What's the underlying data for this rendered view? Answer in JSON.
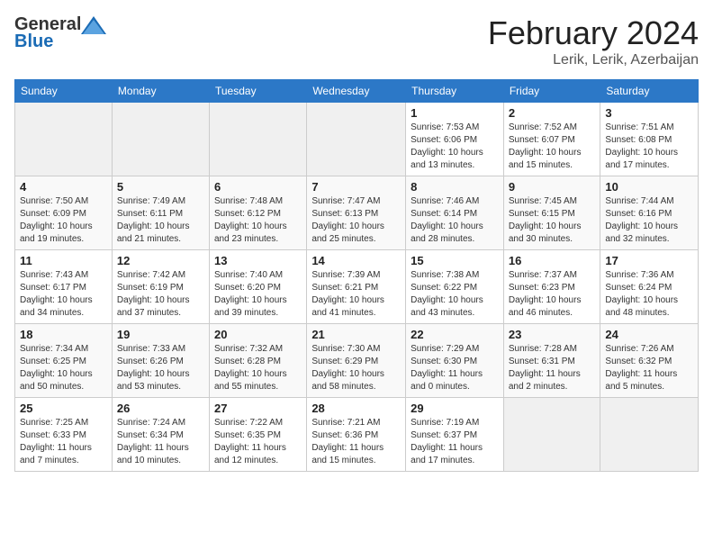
{
  "header": {
    "logo_general": "General",
    "logo_blue": "Blue",
    "title": "February 2024",
    "subtitle": "Lerik, Lerik, Azerbaijan"
  },
  "weekdays": [
    "Sunday",
    "Monday",
    "Tuesday",
    "Wednesday",
    "Thursday",
    "Friday",
    "Saturday"
  ],
  "weeks": [
    [
      {
        "day": "",
        "empty": true
      },
      {
        "day": "",
        "empty": true
      },
      {
        "day": "",
        "empty": true
      },
      {
        "day": "",
        "empty": true
      },
      {
        "day": "1",
        "sunrise": "Sunrise: 7:53 AM",
        "sunset": "Sunset: 6:06 PM",
        "daylight": "Daylight: 10 hours and 13 minutes."
      },
      {
        "day": "2",
        "sunrise": "Sunrise: 7:52 AM",
        "sunset": "Sunset: 6:07 PM",
        "daylight": "Daylight: 10 hours and 15 minutes."
      },
      {
        "day": "3",
        "sunrise": "Sunrise: 7:51 AM",
        "sunset": "Sunset: 6:08 PM",
        "daylight": "Daylight: 10 hours and 17 minutes."
      }
    ],
    [
      {
        "day": "4",
        "sunrise": "Sunrise: 7:50 AM",
        "sunset": "Sunset: 6:09 PM",
        "daylight": "Daylight: 10 hours and 19 minutes."
      },
      {
        "day": "5",
        "sunrise": "Sunrise: 7:49 AM",
        "sunset": "Sunset: 6:11 PM",
        "daylight": "Daylight: 10 hours and 21 minutes."
      },
      {
        "day": "6",
        "sunrise": "Sunrise: 7:48 AM",
        "sunset": "Sunset: 6:12 PM",
        "daylight": "Daylight: 10 hours and 23 minutes."
      },
      {
        "day": "7",
        "sunrise": "Sunrise: 7:47 AM",
        "sunset": "Sunset: 6:13 PM",
        "daylight": "Daylight: 10 hours and 25 minutes."
      },
      {
        "day": "8",
        "sunrise": "Sunrise: 7:46 AM",
        "sunset": "Sunset: 6:14 PM",
        "daylight": "Daylight: 10 hours and 28 minutes."
      },
      {
        "day": "9",
        "sunrise": "Sunrise: 7:45 AM",
        "sunset": "Sunset: 6:15 PM",
        "daylight": "Daylight: 10 hours and 30 minutes."
      },
      {
        "day": "10",
        "sunrise": "Sunrise: 7:44 AM",
        "sunset": "Sunset: 6:16 PM",
        "daylight": "Daylight: 10 hours and 32 minutes."
      }
    ],
    [
      {
        "day": "11",
        "sunrise": "Sunrise: 7:43 AM",
        "sunset": "Sunset: 6:17 PM",
        "daylight": "Daylight: 10 hours and 34 minutes."
      },
      {
        "day": "12",
        "sunrise": "Sunrise: 7:42 AM",
        "sunset": "Sunset: 6:19 PM",
        "daylight": "Daylight: 10 hours and 37 minutes."
      },
      {
        "day": "13",
        "sunrise": "Sunrise: 7:40 AM",
        "sunset": "Sunset: 6:20 PM",
        "daylight": "Daylight: 10 hours and 39 minutes."
      },
      {
        "day": "14",
        "sunrise": "Sunrise: 7:39 AM",
        "sunset": "Sunset: 6:21 PM",
        "daylight": "Daylight: 10 hours and 41 minutes."
      },
      {
        "day": "15",
        "sunrise": "Sunrise: 7:38 AM",
        "sunset": "Sunset: 6:22 PM",
        "daylight": "Daylight: 10 hours and 43 minutes."
      },
      {
        "day": "16",
        "sunrise": "Sunrise: 7:37 AM",
        "sunset": "Sunset: 6:23 PM",
        "daylight": "Daylight: 10 hours and 46 minutes."
      },
      {
        "day": "17",
        "sunrise": "Sunrise: 7:36 AM",
        "sunset": "Sunset: 6:24 PM",
        "daylight": "Daylight: 10 hours and 48 minutes."
      }
    ],
    [
      {
        "day": "18",
        "sunrise": "Sunrise: 7:34 AM",
        "sunset": "Sunset: 6:25 PM",
        "daylight": "Daylight: 10 hours and 50 minutes."
      },
      {
        "day": "19",
        "sunrise": "Sunrise: 7:33 AM",
        "sunset": "Sunset: 6:26 PM",
        "daylight": "Daylight: 10 hours and 53 minutes."
      },
      {
        "day": "20",
        "sunrise": "Sunrise: 7:32 AM",
        "sunset": "Sunset: 6:28 PM",
        "daylight": "Daylight: 10 hours and 55 minutes."
      },
      {
        "day": "21",
        "sunrise": "Sunrise: 7:30 AM",
        "sunset": "Sunset: 6:29 PM",
        "daylight": "Daylight: 10 hours and 58 minutes."
      },
      {
        "day": "22",
        "sunrise": "Sunrise: 7:29 AM",
        "sunset": "Sunset: 6:30 PM",
        "daylight": "Daylight: 11 hours and 0 minutes."
      },
      {
        "day": "23",
        "sunrise": "Sunrise: 7:28 AM",
        "sunset": "Sunset: 6:31 PM",
        "daylight": "Daylight: 11 hours and 2 minutes."
      },
      {
        "day": "24",
        "sunrise": "Sunrise: 7:26 AM",
        "sunset": "Sunset: 6:32 PM",
        "daylight": "Daylight: 11 hours and 5 minutes."
      }
    ],
    [
      {
        "day": "25",
        "sunrise": "Sunrise: 7:25 AM",
        "sunset": "Sunset: 6:33 PM",
        "daylight": "Daylight: 11 hours and 7 minutes."
      },
      {
        "day": "26",
        "sunrise": "Sunrise: 7:24 AM",
        "sunset": "Sunset: 6:34 PM",
        "daylight": "Daylight: 11 hours and 10 minutes."
      },
      {
        "day": "27",
        "sunrise": "Sunrise: 7:22 AM",
        "sunset": "Sunset: 6:35 PM",
        "daylight": "Daylight: 11 hours and 12 minutes."
      },
      {
        "day": "28",
        "sunrise": "Sunrise: 7:21 AM",
        "sunset": "Sunset: 6:36 PM",
        "daylight": "Daylight: 11 hours and 15 minutes."
      },
      {
        "day": "29",
        "sunrise": "Sunrise: 7:19 AM",
        "sunset": "Sunset: 6:37 PM",
        "daylight": "Daylight: 11 hours and 17 minutes."
      },
      {
        "day": "",
        "empty": true
      },
      {
        "day": "",
        "empty": true
      }
    ]
  ]
}
